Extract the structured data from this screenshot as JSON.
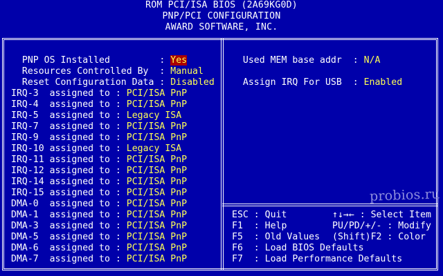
{
  "header": {
    "line1": "ROM PCI/ISA BIOS (2A69KG0D)",
    "line2": "PNP/PCI CONFIGURATION",
    "line3": "AWARD SOFTWARE, INC."
  },
  "left": {
    "settings": [
      {
        "label": "PNP OS Installed        ",
        "sep": " : ",
        "value": "Yes",
        "selected": true
      },
      {
        "label": "Resources Controlled By ",
        "sep": " : ",
        "value": "Manual",
        "selected": false
      },
      {
        "label": "Reset Configuration Data",
        "sep": " : ",
        "value": "Disabled",
        "selected": false
      }
    ],
    "assignments": [
      {
        "label": "IRQ-3  assigned to",
        "sep": " : ",
        "value": "PCI/ISA PnP"
      },
      {
        "label": "IRQ-4  assigned to",
        "sep": " : ",
        "value": "PCI/ISA PnP"
      },
      {
        "label": "IRQ-5  assigned to",
        "sep": " : ",
        "value": "Legacy ISA"
      },
      {
        "label": "IRQ-7  assigned to",
        "sep": " : ",
        "value": "PCI/ISA PnP"
      },
      {
        "label": "IRQ-9  assigned to",
        "sep": " : ",
        "value": "PCI/ISA PnP"
      },
      {
        "label": "IRQ-10 assigned to",
        "sep": " : ",
        "value": "Legacy ISA"
      },
      {
        "label": "IRQ-11 assigned to",
        "sep": " : ",
        "value": "PCI/ISA PnP"
      },
      {
        "label": "IRQ-12 assigned to",
        "sep": " : ",
        "value": "PCI/ISA PnP"
      },
      {
        "label": "IRQ-14 assigned to",
        "sep": " : ",
        "value": "PCI/ISA PnP"
      },
      {
        "label": "IRQ-15 assigned to",
        "sep": " : ",
        "value": "PCI/ISA PnP"
      },
      {
        "label": "DMA-0  assigned to",
        "sep": " : ",
        "value": "PCI/ISA PnP"
      },
      {
        "label": "DMA-1  assigned to",
        "sep": " : ",
        "value": "PCI/ISA PnP"
      },
      {
        "label": "DMA-3  assigned to",
        "sep": " : ",
        "value": "PCI/ISA PnP"
      },
      {
        "label": "DMA-5  assigned to",
        "sep": " : ",
        "value": "PCI/ISA PnP"
      },
      {
        "label": "DMA-6  assigned to",
        "sep": " : ",
        "value": "PCI/ISA PnP"
      },
      {
        "label": "DMA-7  assigned to",
        "sep": " : ",
        "value": "PCI/ISA PnP"
      }
    ]
  },
  "right": {
    "settings": [
      {
        "label": "Used MEM base addr",
        "sep": "  : ",
        "value": "N/A"
      },
      {
        "label": "Assign IRQ For USB",
        "sep": "  : ",
        "value": "Enabled"
      }
    ]
  },
  "help": {
    "esc_key": "ESC :",
    "esc_text": " Quit",
    "nav_keys": "↑↓→←",
    "nav_text": " : Select Item",
    "f1_key": "F1  :",
    "f1_text": " Help",
    "modify_keys": "PU/PD/+/-",
    "modify_text": " : Modify",
    "f5_key": "F5  :",
    "f5_text": " Old Values",
    "shiftf2_keys": "(Shift)F2",
    "shiftf2_text": " : Color",
    "f6_key": "F6  :",
    "f6_text": " Load BIOS Defaults",
    "f7_key": "F7  :",
    "f7_text": " Load Performance Defaults"
  },
  "watermark": "probios.ru",
  "colors": {
    "background": "#0000aa",
    "label": "#ffffff",
    "value": "#ffff55",
    "selected_bg": "#aa0000"
  }
}
